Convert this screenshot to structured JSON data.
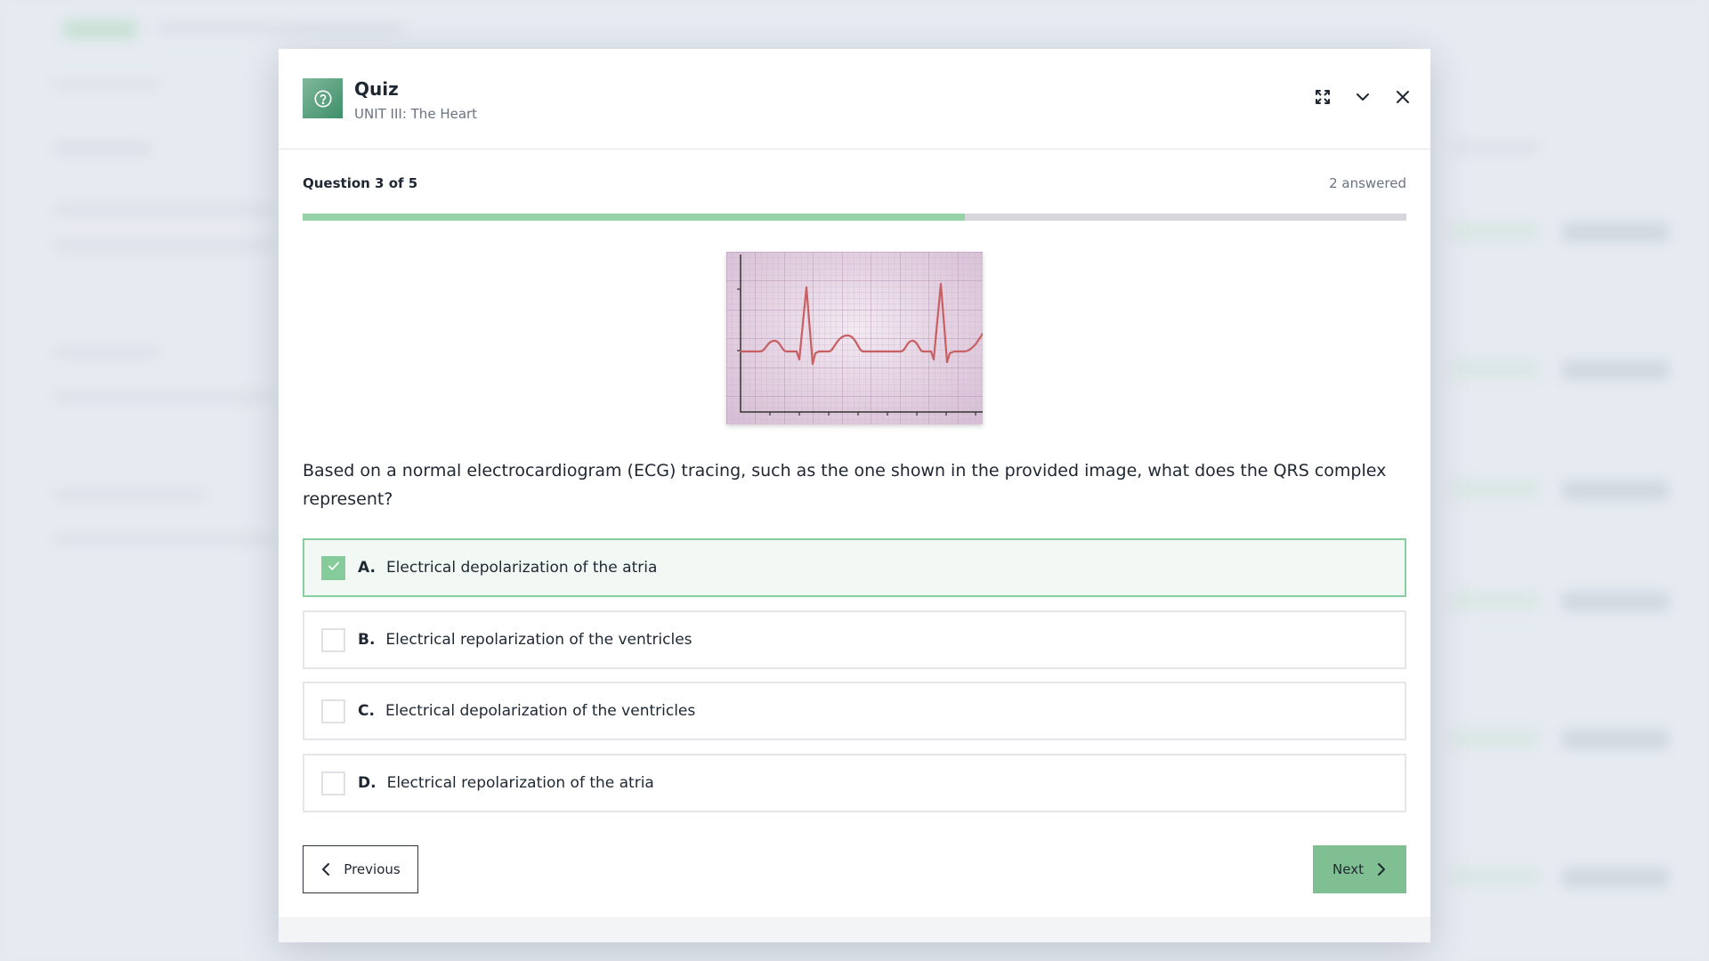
{
  "colors": {
    "accent": "#7fbf91",
    "progress_fill": "#95d2a7",
    "selected_border": "#88cf9f",
    "selected_bg": "#f2f9f4",
    "icon_bg": "#3f8f6a"
  },
  "header": {
    "icon": "question-circle-icon",
    "title": "Quiz",
    "subtitle": "UNIT III: The Heart",
    "actions": [
      "expand-icon",
      "chevron-down-icon",
      "close-icon"
    ]
  },
  "progress": {
    "label": "Question 3 of 5",
    "answered_text": "2 answered",
    "current": 3,
    "total": 5,
    "fraction": 0.6
  },
  "question": {
    "figure": "ecg-tracing",
    "text": "Based on a normal electrocardiogram (ECG) tracing, such as the one shown in the provided image, what does the QRS complex represent?",
    "options": [
      {
        "letter": "A.",
        "text": "Electrical depolarization of the atria",
        "selected": true
      },
      {
        "letter": "B.",
        "text": "Electrical repolarization of the ventricles",
        "selected": false
      },
      {
        "letter": "C.",
        "text": "Electrical depolarization of the ventricles",
        "selected": false
      },
      {
        "letter": "D.",
        "text": "Electrical repolarization of the atria",
        "selected": false
      }
    ]
  },
  "footer": {
    "previous_label": "Previous",
    "next_label": "Next",
    "previous_icon": "chevron-left-icon",
    "next_icon": "chevron-right-icon"
  }
}
